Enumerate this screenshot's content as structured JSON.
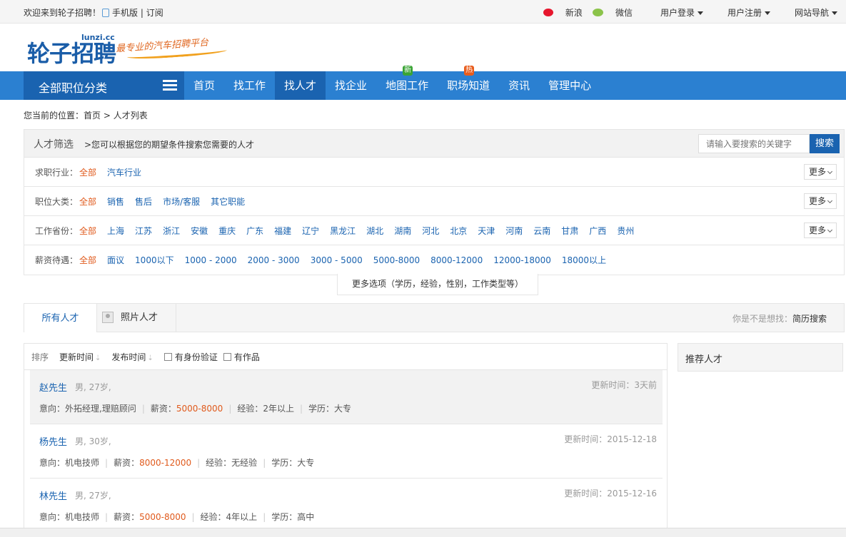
{
  "topbar": {
    "welcome": "欢迎来到轮子招聘！",
    "mobile": "手机版",
    "sep": "|",
    "subscribe": "订阅",
    "weibo": "新浪",
    "wechat": "微信",
    "login": "用户登录",
    "register": "用户注册",
    "sitenav": "网站导航"
  },
  "logo": {
    "text": "轮子招聘",
    "url": "lunzi.cc",
    "slogan": "最专业的汽车招聘平台"
  },
  "nav": {
    "category": "全部职位分类",
    "items": [
      {
        "label": "首页"
      },
      {
        "label": "找工作"
      },
      {
        "label": "找人才"
      },
      {
        "label": "找企业"
      },
      {
        "label": "地图工作",
        "badge": "新"
      },
      {
        "label": "职场知道",
        "badge": "热"
      },
      {
        "label": "资讯"
      },
      {
        "label": "管理中心"
      }
    ]
  },
  "breadcrumb": {
    "prefix": "您当前的位置：",
    "home": "首页",
    "arrow": ">",
    "current": "人才列表"
  },
  "filter": {
    "title": "人才筛选",
    "desc": ">您可以根据您的期望条件搜索您需要的人才",
    "search_placeholder": "请输入要搜索的关键字",
    "search_button": "搜索",
    "more_label": "更多",
    "rows": [
      {
        "label": "求职行业：",
        "all": "全部",
        "options": [
          "汽车行业"
        ]
      },
      {
        "label": "职位大类：",
        "all": "全部",
        "options": [
          "销售",
          "售后",
          "市场/客服",
          "其它职能"
        ]
      },
      {
        "label": "工作省份：",
        "all": "全部",
        "options": [
          "上海",
          "江苏",
          "浙江",
          "安徽",
          "重庆",
          "广东",
          "福建",
          "辽宁",
          "黑龙江",
          "湖北",
          "湖南",
          "河北",
          "北京",
          "天津",
          "河南",
          "云南",
          "甘肃",
          "广西",
          "贵州"
        ]
      },
      {
        "label": "薪资待遇：",
        "all": "全部",
        "options": [
          "面议",
          "1000以下",
          "1000 - 2000",
          "2000 - 3000",
          "3000 - 5000",
          "5000-8000",
          "8000-12000",
          "12000-18000",
          "18000以上"
        ]
      }
    ],
    "more_options": "更多选项（学历，经验，性别，工作类型等）"
  },
  "tabs": {
    "all": "所有人才",
    "photo": "照片人才",
    "suggest_prefix": "你是不是想找：",
    "suggest_link": "简历搜索"
  },
  "sort": {
    "label": "排序",
    "by_update": "更新时间",
    "by_publish": "发布时间",
    "arrow": "⇣",
    "id_verified": "有身份验证",
    "has_work": "有作品"
  },
  "people": [
    {
      "name": "赵先生",
      "meta": "男, 27岁,",
      "updated": "更新时间：3天前",
      "intent": "意向：外拓经理,理赔顾问",
      "salary_label": "薪资：",
      "salary": "5000-8000",
      "exp": "经验：2年以上",
      "edu": "学历：大专"
    },
    {
      "name": "杨先生",
      "meta": "男, 30岁,",
      "updated": "更新时间：2015-12-18",
      "intent": "意向：机电技师",
      "salary_label": "薪资：",
      "salary": "8000-12000",
      "exp": "经验：无经验",
      "edu": "学历：大专"
    },
    {
      "name": "林先生",
      "meta": "男, 27岁,",
      "updated": "更新时间：2015-12-16",
      "intent": "意向：机电技师",
      "salary_label": "薪资：",
      "salary": "5000-8000",
      "exp": "经验：4年以上",
      "edu": "学历：高中"
    }
  ],
  "sidebar": {
    "title": "推荐人才"
  },
  "colors": {
    "nav": "#2b80d1",
    "nav_dark": "#1a63b0",
    "accent": "#e05a1c",
    "link": "#1a63b0"
  }
}
